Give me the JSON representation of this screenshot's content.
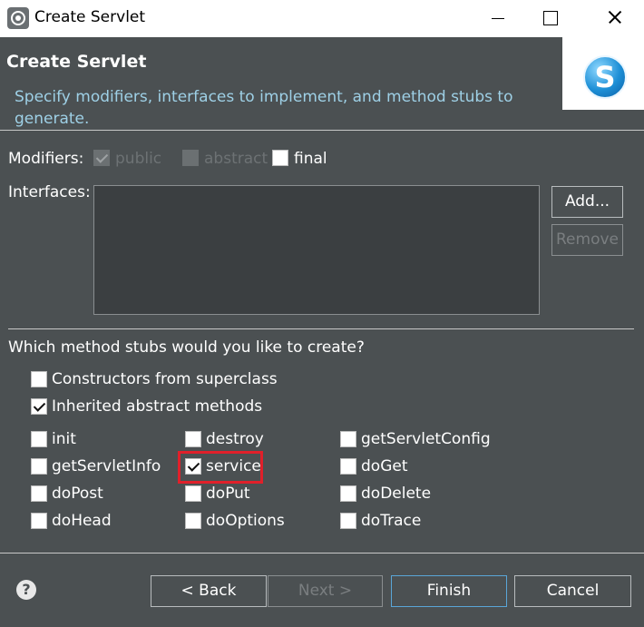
{
  "window": {
    "title": "Create Servlet"
  },
  "header": {
    "title": "Create Servlet",
    "description": "Specify modifiers, interfaces to implement, and method stubs to generate.",
    "logo_letter": "S"
  },
  "modifiers": {
    "label": "Modifiers:",
    "public": {
      "label": "public",
      "checked": true,
      "enabled": false
    },
    "abstract": {
      "label": "abstract",
      "checked": false,
      "enabled": false
    },
    "final": {
      "label": "final",
      "checked": false,
      "enabled": true
    }
  },
  "interfaces": {
    "label": "Interfaces:",
    "items": [],
    "add_label": "Add...",
    "remove_label": "Remove"
  },
  "stubs": {
    "question": "Which method stubs would you like to create?",
    "constructors": {
      "label": "Constructors from superclass",
      "checked": false
    },
    "inherited": {
      "label": "Inherited abstract methods",
      "checked": true
    },
    "methods": [
      {
        "label": "init",
        "checked": false
      },
      {
        "label": "destroy",
        "checked": false
      },
      {
        "label": "getServletConfig",
        "checked": false
      },
      {
        "label": "getServletInfo",
        "checked": false
      },
      {
        "label": "service",
        "checked": true
      },
      {
        "label": "doGet",
        "checked": false
      },
      {
        "label": "doPost",
        "checked": false
      },
      {
        "label": "doPut",
        "checked": false
      },
      {
        "label": "doDelete",
        "checked": false
      },
      {
        "label": "doHead",
        "checked": false
      },
      {
        "label": "doOptions",
        "checked": false
      },
      {
        "label": "doTrace",
        "checked": false
      }
    ]
  },
  "footer": {
    "help_symbol": "?",
    "back_label": "< Back",
    "next_label": "Next >",
    "finish_label": "Finish",
    "cancel_label": "Cancel"
  },
  "colors": {
    "background": "#4b5052",
    "description": "#9ed0e6",
    "highlight": "#e0202a"
  }
}
